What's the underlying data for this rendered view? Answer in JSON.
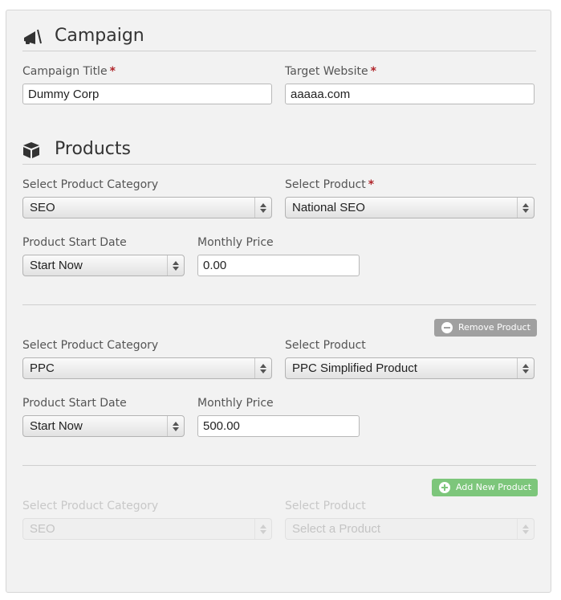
{
  "campaign": {
    "heading": "Campaign",
    "icon": "bullhorn-icon",
    "title_label": "Campaign Title",
    "title_value": "Dummy Corp",
    "website_label": "Target Website",
    "website_value": "aaaaa.com",
    "required_mark": "*"
  },
  "products": {
    "heading": "Products",
    "icon": "cube-icon",
    "items": [
      {
        "category_label": "Select Product Category",
        "category_value": "SEO",
        "product_label": "Select Product",
        "product_required": "*",
        "product_value": "National SEO",
        "start_label": "Product Start Date",
        "start_value": "Start Now",
        "price_label": "Monthly Price",
        "price_value": "0.00"
      },
      {
        "remove_label": "Remove Product",
        "category_label": "Select Product Category",
        "category_value": "PPC",
        "product_label": "Select Product",
        "product_value": "PPC Simplified Product",
        "start_label": "Product Start Date",
        "start_value": "Start Now",
        "price_label": "Monthly Price",
        "price_value": "500.00"
      }
    ],
    "add_label": "Add New Product",
    "new_item": {
      "category_label": "Select Product Category",
      "category_value": "SEO",
      "product_label": "Select Product",
      "product_value": "Select a Product"
    }
  },
  "colors": {
    "required": "#b0252a",
    "add_button": "#7dc67b",
    "remove_button": "#a0a0a0"
  }
}
